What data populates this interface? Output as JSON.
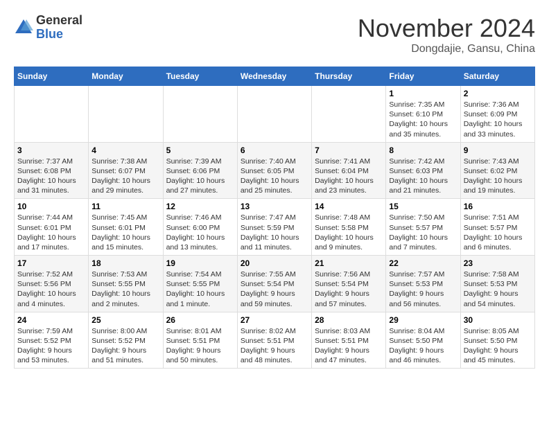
{
  "header": {
    "logo_general": "General",
    "logo_blue": "Blue",
    "month_title": "November 2024",
    "location": "Dongdajie, Gansu, China"
  },
  "weekdays": [
    "Sunday",
    "Monday",
    "Tuesday",
    "Wednesday",
    "Thursday",
    "Friday",
    "Saturday"
  ],
  "weeks": [
    [
      {
        "day": "",
        "info": ""
      },
      {
        "day": "",
        "info": ""
      },
      {
        "day": "",
        "info": ""
      },
      {
        "day": "",
        "info": ""
      },
      {
        "day": "",
        "info": ""
      },
      {
        "day": "1",
        "info": "Sunrise: 7:35 AM\nSunset: 6:10 PM\nDaylight: 10 hours\nand 35 minutes."
      },
      {
        "day": "2",
        "info": "Sunrise: 7:36 AM\nSunset: 6:09 PM\nDaylight: 10 hours\nand 33 minutes."
      }
    ],
    [
      {
        "day": "3",
        "info": "Sunrise: 7:37 AM\nSunset: 6:08 PM\nDaylight: 10 hours\nand 31 minutes."
      },
      {
        "day": "4",
        "info": "Sunrise: 7:38 AM\nSunset: 6:07 PM\nDaylight: 10 hours\nand 29 minutes."
      },
      {
        "day": "5",
        "info": "Sunrise: 7:39 AM\nSunset: 6:06 PM\nDaylight: 10 hours\nand 27 minutes."
      },
      {
        "day": "6",
        "info": "Sunrise: 7:40 AM\nSunset: 6:05 PM\nDaylight: 10 hours\nand 25 minutes."
      },
      {
        "day": "7",
        "info": "Sunrise: 7:41 AM\nSunset: 6:04 PM\nDaylight: 10 hours\nand 23 minutes."
      },
      {
        "day": "8",
        "info": "Sunrise: 7:42 AM\nSunset: 6:03 PM\nDaylight: 10 hours\nand 21 minutes."
      },
      {
        "day": "9",
        "info": "Sunrise: 7:43 AM\nSunset: 6:02 PM\nDaylight: 10 hours\nand 19 minutes."
      }
    ],
    [
      {
        "day": "10",
        "info": "Sunrise: 7:44 AM\nSunset: 6:01 PM\nDaylight: 10 hours\nand 17 minutes."
      },
      {
        "day": "11",
        "info": "Sunrise: 7:45 AM\nSunset: 6:01 PM\nDaylight: 10 hours\nand 15 minutes."
      },
      {
        "day": "12",
        "info": "Sunrise: 7:46 AM\nSunset: 6:00 PM\nDaylight: 10 hours\nand 13 minutes."
      },
      {
        "day": "13",
        "info": "Sunrise: 7:47 AM\nSunset: 5:59 PM\nDaylight: 10 hours\nand 11 minutes."
      },
      {
        "day": "14",
        "info": "Sunrise: 7:48 AM\nSunset: 5:58 PM\nDaylight: 10 hours\nand 9 minutes."
      },
      {
        "day": "15",
        "info": "Sunrise: 7:50 AM\nSunset: 5:57 PM\nDaylight: 10 hours\nand 7 minutes."
      },
      {
        "day": "16",
        "info": "Sunrise: 7:51 AM\nSunset: 5:57 PM\nDaylight: 10 hours\nand 6 minutes."
      }
    ],
    [
      {
        "day": "17",
        "info": "Sunrise: 7:52 AM\nSunset: 5:56 PM\nDaylight: 10 hours\nand 4 minutes."
      },
      {
        "day": "18",
        "info": "Sunrise: 7:53 AM\nSunset: 5:55 PM\nDaylight: 10 hours\nand 2 minutes."
      },
      {
        "day": "19",
        "info": "Sunrise: 7:54 AM\nSunset: 5:55 PM\nDaylight: 10 hours\nand 1 minute."
      },
      {
        "day": "20",
        "info": "Sunrise: 7:55 AM\nSunset: 5:54 PM\nDaylight: 9 hours\nand 59 minutes."
      },
      {
        "day": "21",
        "info": "Sunrise: 7:56 AM\nSunset: 5:54 PM\nDaylight: 9 hours\nand 57 minutes."
      },
      {
        "day": "22",
        "info": "Sunrise: 7:57 AM\nSunset: 5:53 PM\nDaylight: 9 hours\nand 56 minutes."
      },
      {
        "day": "23",
        "info": "Sunrise: 7:58 AM\nSunset: 5:53 PM\nDaylight: 9 hours\nand 54 minutes."
      }
    ],
    [
      {
        "day": "24",
        "info": "Sunrise: 7:59 AM\nSunset: 5:52 PM\nDaylight: 9 hours\nand 53 minutes."
      },
      {
        "day": "25",
        "info": "Sunrise: 8:00 AM\nSunset: 5:52 PM\nDaylight: 9 hours\nand 51 minutes."
      },
      {
        "day": "26",
        "info": "Sunrise: 8:01 AM\nSunset: 5:51 PM\nDaylight: 9 hours\nand 50 minutes."
      },
      {
        "day": "27",
        "info": "Sunrise: 8:02 AM\nSunset: 5:51 PM\nDaylight: 9 hours\nand 48 minutes."
      },
      {
        "day": "28",
        "info": "Sunrise: 8:03 AM\nSunset: 5:51 PM\nDaylight: 9 hours\nand 47 minutes."
      },
      {
        "day": "29",
        "info": "Sunrise: 8:04 AM\nSunset: 5:50 PM\nDaylight: 9 hours\nand 46 minutes."
      },
      {
        "day": "30",
        "info": "Sunrise: 8:05 AM\nSunset: 5:50 PM\nDaylight: 9 hours\nand 45 minutes."
      }
    ]
  ]
}
